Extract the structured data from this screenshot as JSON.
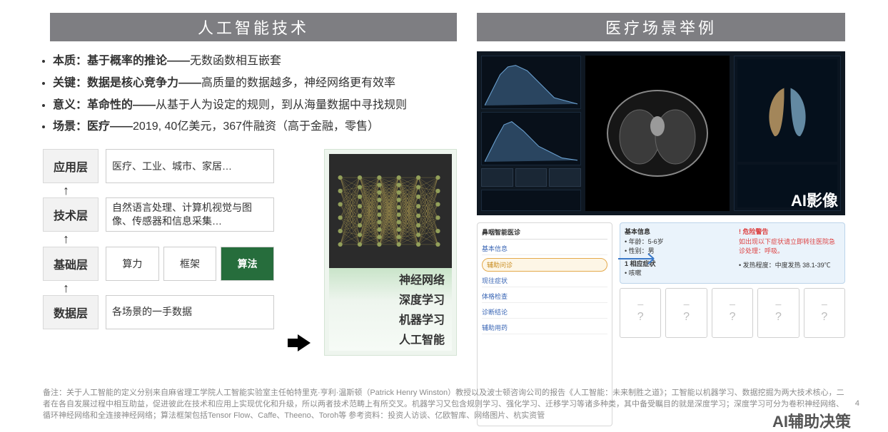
{
  "headers": {
    "left": "人工智能技术",
    "right": "医疗场景举例"
  },
  "bullets": [
    {
      "prefix": "本质：",
      "bold": "基于概率的推论——",
      "tail": "无数函数相互嵌套"
    },
    {
      "prefix": "关键：",
      "bold": "数据是核心竞争力——",
      "tail": "高质量的数据越多，神经网络更有效率"
    },
    {
      "prefix": "意义：",
      "bold": "革命性的——",
      "tail": "从基于人为设定的规则，到从海量数据中寻找规则"
    },
    {
      "prefix": "场景：",
      "bold": "医疗——",
      "tail": "2019, 40亿美元，367件融资（高于金融，零售）"
    }
  ],
  "layers": {
    "app": {
      "label": "应用层",
      "body": "医疗、工业、城市、家居…"
    },
    "tech": {
      "label": "技术层",
      "body": "自然语言处理、计算机视觉与图像、传感器和信息采集…"
    },
    "base": {
      "label": "基础层",
      "c1": "算力",
      "c2": "框架",
      "c3": "算法"
    },
    "data": {
      "label": "数据层",
      "body": "各场景的一手数据"
    }
  },
  "nn_labels": [
    "神经网络",
    "深度学习",
    "机器学习",
    "人工智能"
  ],
  "right_labels": {
    "imaging": "AI影像",
    "decision": "AI辅助决策"
  },
  "rb_panel": {
    "title": "鼻咽智能医诊",
    "pill": "辅助问诊",
    "lines": [
      "基本信息",
      "现往症状",
      "体格检查",
      "诊断结论",
      "辅助用药"
    ],
    "patient": {
      "h1": "基本信息",
      "l1": "• 年龄：5-6岁",
      "l2": "• 性别：男"
    },
    "alert": {
      "h1": "! 危险警告",
      "body": "如出现以下症状请立即转往医院急诊处理：呼吸。"
    },
    "sym": {
      "h1": "1 相应症状",
      "l1": "• 咳嗽",
      "l2": "• 发热程度：中度发热 38.1-39℃"
    }
  },
  "footnote": "备注：关于人工智能的定义分别来自麻省理工学院人工智能实验室主任帕特里克·亨利·温斯顿（Patrick Henry Winston）教授以及波士顿咨询公司的报告《人工智能：未来制胜之道》；工智能以机器学习、数据挖掘为两大技术核心，二者在各自发展过程中相互助益，促进彼此在技术和应用上实现优化和升级，所以两者技术范畴上有所交叉。机器学习又包含规则学习、强化学习、迁移学习等诸多种类，其中备受瞩目的就是深度学习；深度学习可分为卷积神经网络、循环神经网络和全连接神经网络；算法框架包括Tensor Flow、Caffe、Theeno、Toroh等\n参考资料：投资人访谈、亿欧智库、网络图片、杭实资管",
  "page_number": "4"
}
